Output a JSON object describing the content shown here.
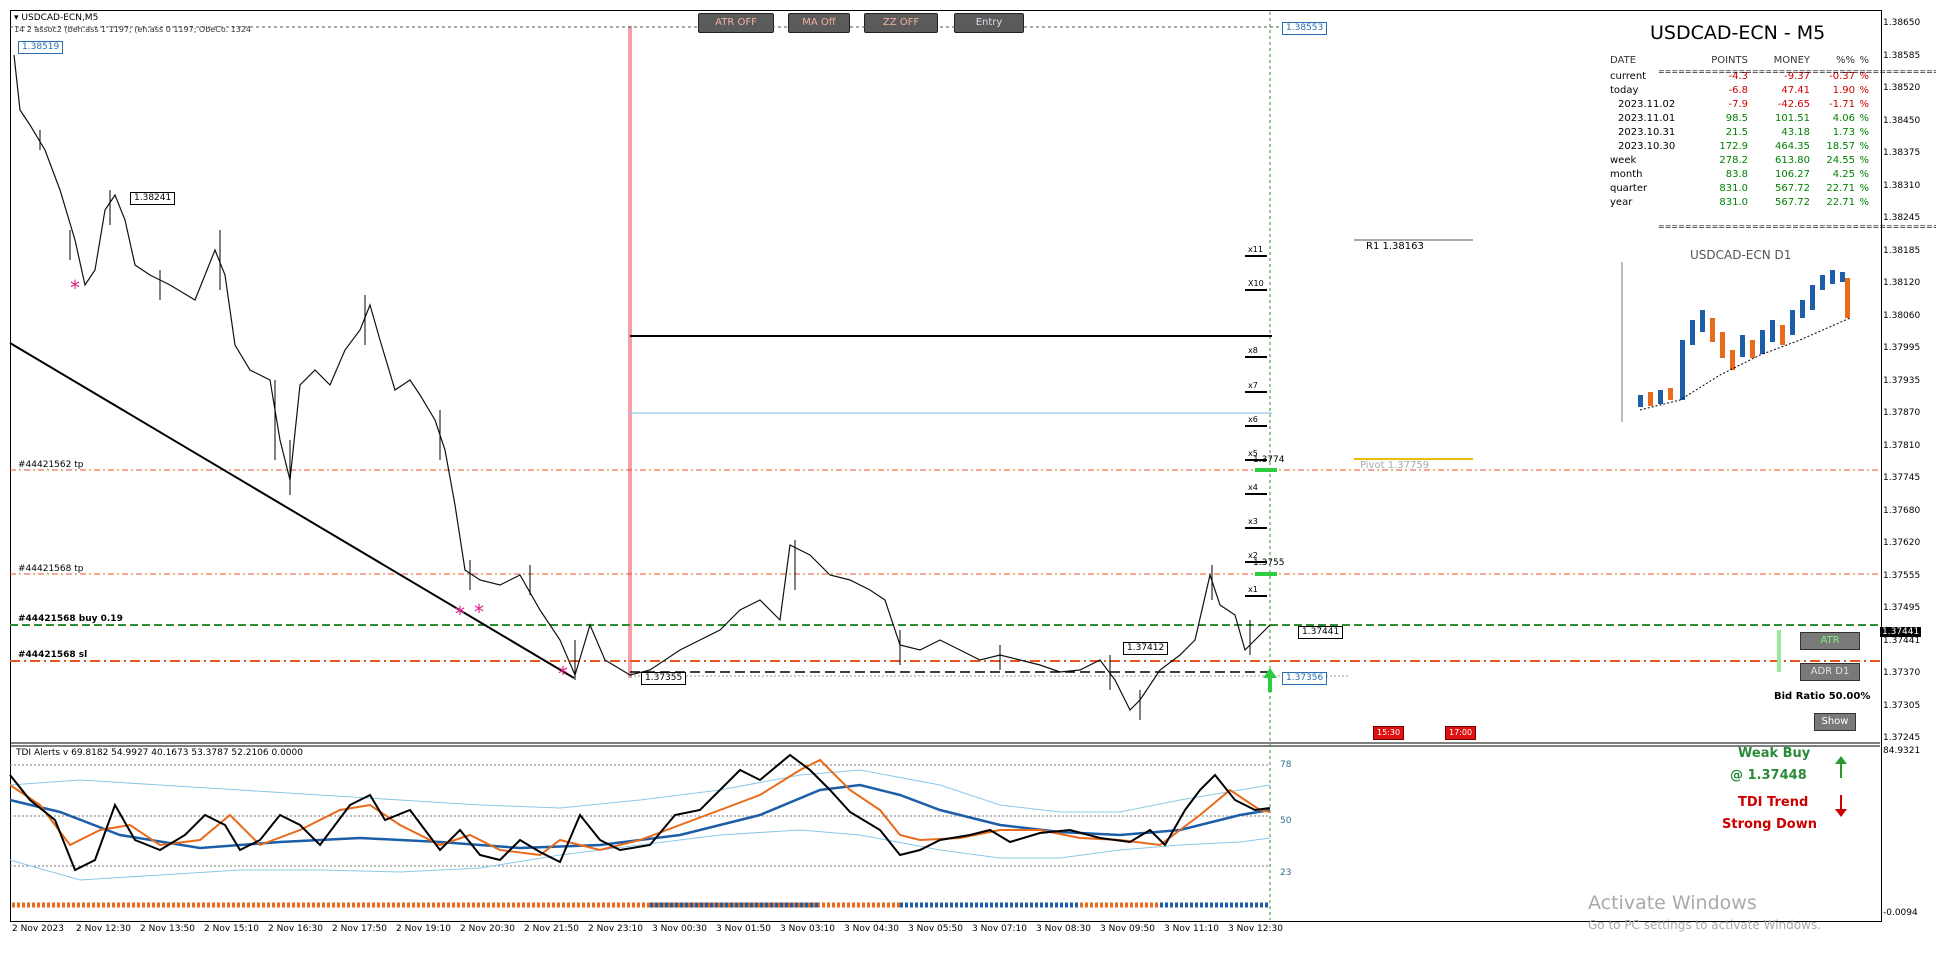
{
  "chart": {
    "header_symbol": "USDCAD-ECN,M5",
    "header_info": "14 2 assoc2 (beh.ass 1 1197; (eh.ass 0 1197; ObeCo. 1324",
    "indicator_header": "TDI Alerts v 69.8182 54.9927 40.1673 53.3787 52.2106 0.0000"
  },
  "toolbar": {
    "atr_label": "ATR OFF",
    "ma_label": "MA Off",
    "zz_label": "ZZ OFF",
    "entry_label": "Entry"
  },
  "price_axis": [
    "1.38650",
    "1.38585",
    "1.38520",
    "1.38450",
    "1.38375",
    "1.38310",
    "1.38245",
    "1.38185",
    "1.38120",
    "1.38060",
    "1.37995",
    "1.37935",
    "1.37870",
    "1.37810",
    "1.37745",
    "1.37680",
    "1.37620",
    "1.37555",
    "1.37495",
    "1.37441",
    "1.37370",
    "1.37305",
    "1.37245"
  ],
  "indicator_axis": {
    "top": "84.9321",
    "bottom": "-0.0094"
  },
  "tdi_levels": [
    "78",
    "50",
    "23"
  ],
  "time_axis": [
    "2 Nov 2023",
    "2 Nov 12:30",
    "2 Nov 13:50",
    "2 Nov 15:10",
    "2 Nov 16:30",
    "2 Nov 17:50",
    "2 Nov 19:10",
    "2 Nov 20:30",
    "2 Nov 21:50",
    "2 Nov 23:10",
    "3 Nov 00:30",
    "3 Nov 01:50",
    "3 Nov 03:10",
    "3 Nov 04:30",
    "3 Nov 05:50",
    "3 Nov 07:10",
    "3 Nov 08:30",
    "3 Nov 09:50",
    "3 Nov 11:10",
    "3 Nov 12:30"
  ],
  "price_labels": {
    "high_left": "1.38519",
    "high_mid": "1.38241",
    "low_mid": "1.37355",
    "mid_right": "1.37412",
    "current": "1.37441",
    "top_right": "1.38553",
    "bottom_right": "1.37356",
    "tp1_value": "1.3774",
    "tp2_value": "1.3755",
    "r1": "R1 1.38163",
    "pivot": "Pivot 1.37759"
  },
  "order_labels": {
    "tp1": "#44421562 tp",
    "tp2": "#44421568 tp",
    "buy": "#44421568 buy 0.19",
    "sl": "#44421568 sl"
  },
  "levels": [
    "x11",
    "X10",
    "x8",
    "x7",
    "x6",
    "x5",
    "x4",
    "x3",
    "x2",
    "x1"
  ],
  "stats": {
    "title": "USDCAD-ECN - M5",
    "headers": [
      "DATE",
      "POINTS",
      "MONEY",
      "%%",
      "%"
    ],
    "separator": "==========================================",
    "rows": [
      {
        "date": "current",
        "points": "-4.3",
        "money": "-9.37",
        "pct": "-0.37",
        "unit": "%",
        "color": "#cc0000"
      },
      {
        "date": "today",
        "points": "-6.8",
        "money": "47.41",
        "pct": "1.90",
        "unit": "%",
        "color": "#cc0000"
      },
      {
        "date": "2023.11.02",
        "points": "-7.9",
        "money": "-42.65",
        "pct": "-1.71",
        "unit": "%",
        "color": "#cc0000"
      },
      {
        "date": "2023.11.01",
        "points": "98.5",
        "money": "101.51",
        "pct": "4.06",
        "unit": "%",
        "color": "#008000"
      },
      {
        "date": "2023.10.31",
        "points": "21.5",
        "money": "43.18",
        "pct": "1.73",
        "unit": "%",
        "color": "#008000"
      },
      {
        "date": "2023.10.30",
        "points": "172.9",
        "money": "464.35",
        "pct": "18.57",
        "unit": "%",
        "color": "#008000"
      },
      {
        "date": "week",
        "points": "278.2",
        "money": "613.80",
        "pct": "24.55",
        "unit": "%",
        "color": "#008000"
      },
      {
        "date": "month",
        "points": "83.8",
        "money": "106.27",
        "pct": "4.25",
        "unit": "%",
        "color": "#008000"
      },
      {
        "date": "quarter",
        "points": "831.0",
        "money": "567.72",
        "pct": "22.71",
        "unit": "%",
        "color": "#008000"
      },
      {
        "date": "year",
        "points": "831.0",
        "money": "567.72",
        "pct": "22.71",
        "unit": "%",
        "color": "#008000"
      }
    ]
  },
  "mini_chart": {
    "title": "USDCAD-ECN D1"
  },
  "panel_buttons": {
    "atr": "ATR",
    "adr": "ADR D1",
    "show": "Show"
  },
  "bid_ratio": "Bid Ratio 50.00%",
  "session_tags": [
    "15:30",
    "17:00"
  ],
  "signals": {
    "weak_buy": "Weak Buy",
    "weak_buy_price": "@ 1.37448",
    "tdi_trend": "TDI Trend",
    "strong_down": "Strong Down"
  },
  "watermark": {
    "line1": "Activate Windows",
    "line2": "Go to PC settings to activate Windows."
  },
  "colors": {
    "up_green": "#008000",
    "down_red": "#cc0000",
    "buy_line": "#2f8f2f",
    "sl_line": "#e8541e",
    "tp_line": "#e8541e"
  }
}
